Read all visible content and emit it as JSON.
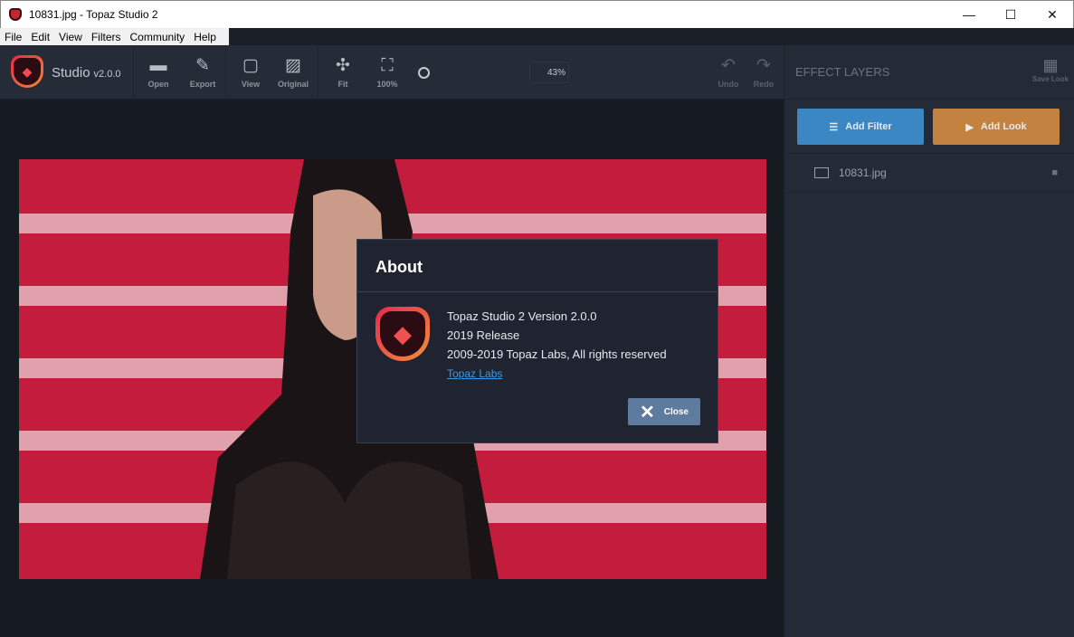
{
  "window": {
    "title": "10831.jpg - Topaz Studio 2",
    "minimize": "—",
    "maximize": "☐",
    "close": "✕"
  },
  "menu": [
    "File",
    "Edit",
    "View",
    "Filters",
    "Community",
    "Help"
  ],
  "brand": {
    "name": "Studio",
    "version": "v2.0.0"
  },
  "toolbar": {
    "open": "Open",
    "export": "Export",
    "view": "View",
    "original": "Original",
    "fit": "Fit",
    "full": "100%",
    "zoom": "43%",
    "undo": "Undo",
    "redo": "Redo"
  },
  "panel": {
    "title": "EFFECT LAYERS",
    "save_look": "Save Look",
    "add_filter": "Add Filter",
    "add_look": "Add Look",
    "layer": "10831.jpg"
  },
  "about": {
    "title": "About",
    "line1": "Topaz Studio 2 Version 2.0.0",
    "line2": "2019 Release",
    "line3": "2009-2019 Topaz Labs, All rights reserved",
    "link": "Topaz Labs",
    "close": "Close"
  },
  "colors": {
    "add_filter": "#3a87c4",
    "add_look": "#c3823f",
    "close": "#5e7a9e",
    "link": "#3d9be0"
  }
}
